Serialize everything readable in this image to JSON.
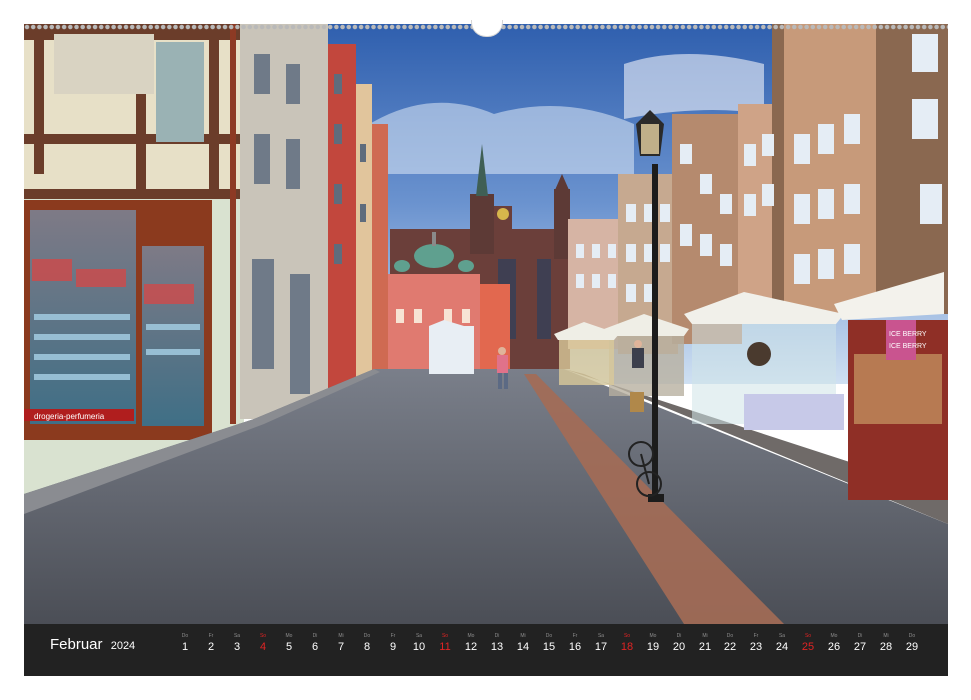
{
  "calendar": {
    "month": "Februar",
    "year": "2024",
    "days": [
      {
        "wd": "Do",
        "n": "1"
      },
      {
        "wd": "Fr",
        "n": "2"
      },
      {
        "wd": "Sa",
        "n": "3"
      },
      {
        "wd": "So",
        "n": "4",
        "sunday": true
      },
      {
        "wd": "Mo",
        "n": "5"
      },
      {
        "wd": "Di",
        "n": "6"
      },
      {
        "wd": "Mi",
        "n": "7"
      },
      {
        "wd": "Do",
        "n": "8"
      },
      {
        "wd": "Fr",
        "n": "9"
      },
      {
        "wd": "Sa",
        "n": "10"
      },
      {
        "wd": "So",
        "n": "11",
        "sunday": true
      },
      {
        "wd": "Mo",
        "n": "12"
      },
      {
        "wd": "Di",
        "n": "13"
      },
      {
        "wd": "Mi",
        "n": "14"
      },
      {
        "wd": "Do",
        "n": "15"
      },
      {
        "wd": "Fr",
        "n": "16"
      },
      {
        "wd": "Sa",
        "n": "17"
      },
      {
        "wd": "So",
        "n": "18",
        "sunday": true
      },
      {
        "wd": "Mo",
        "n": "19"
      },
      {
        "wd": "Di",
        "n": "20"
      },
      {
        "wd": "Mi",
        "n": "21"
      },
      {
        "wd": "Do",
        "n": "22"
      },
      {
        "wd": "Fr",
        "n": "23"
      },
      {
        "wd": "Sa",
        "n": "24"
      },
      {
        "wd": "So",
        "n": "25",
        "sunday": true
      },
      {
        "wd": "Mo",
        "n": "26"
      },
      {
        "wd": "Di",
        "n": "27"
      },
      {
        "wd": "Mi",
        "n": "28"
      },
      {
        "wd": "Do",
        "n": "29"
      }
    ]
  },
  "photo": {
    "shop_sign": "drogeria-perfumeria",
    "stall_sign_line1": "ICE BERRY",
    "stall_sign_line2": "ICE BERRY"
  },
  "colors": {
    "strip_background": "#222222",
    "sunday": "#e02424",
    "sky": "#5b82c4",
    "pavement": "#5d6068"
  }
}
